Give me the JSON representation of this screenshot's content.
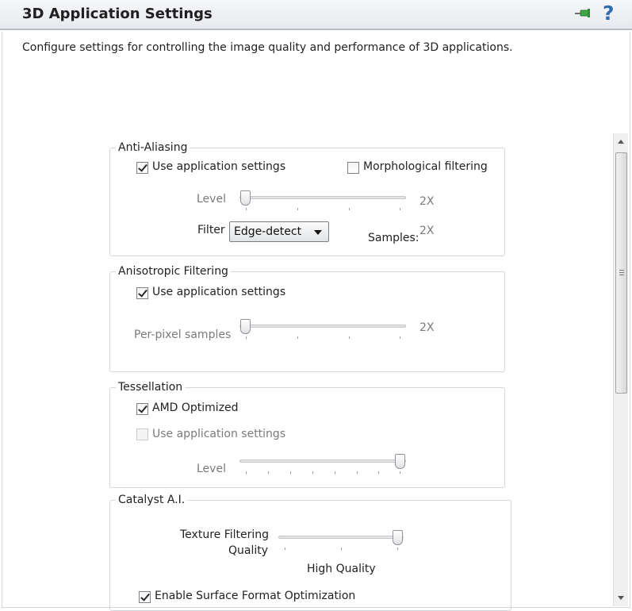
{
  "header": {
    "title": "3D Application Settings",
    "pin_icon": "pin-icon",
    "help_icon": "help-icon",
    "help_glyph": "?"
  },
  "description": "Configure settings for controlling the image quality and performance of 3D applications.",
  "anti_aliasing": {
    "title": "Anti-Aliasing",
    "use_app_settings": {
      "label": "Use application settings",
      "checked": true
    },
    "morphological": {
      "label": "Morphological filtering",
      "checked": false
    },
    "level": {
      "label": "Level",
      "value": "2X",
      "position": 0
    },
    "filter": {
      "label": "Filter",
      "selected": "Edge-detect"
    },
    "samples": {
      "label": "Samples:",
      "value": "2X"
    }
  },
  "anisotropic": {
    "title": "Anisotropic Filtering",
    "use_app_settings": {
      "label": "Use application settings",
      "checked": true
    },
    "per_pixel": {
      "label": "Per-pixel samples",
      "value": "2X",
      "position": 0
    }
  },
  "tessellation": {
    "title": "Tessellation",
    "amd_optimized": {
      "label": "AMD Optimized",
      "checked": true
    },
    "use_app_settings": {
      "label": "Use application settings",
      "checked": false,
      "disabled": true
    },
    "level": {
      "label": "Level",
      "position": 1
    }
  },
  "catalyst_ai": {
    "title": "Catalyst A.I.",
    "texture_quality": {
      "label_line1": "Texture Filtering",
      "label_line2": "Quality",
      "value": "High Quality",
      "position": 1
    },
    "surface_format": {
      "label": "Enable Surface Format Optimization",
      "checked": true
    }
  }
}
